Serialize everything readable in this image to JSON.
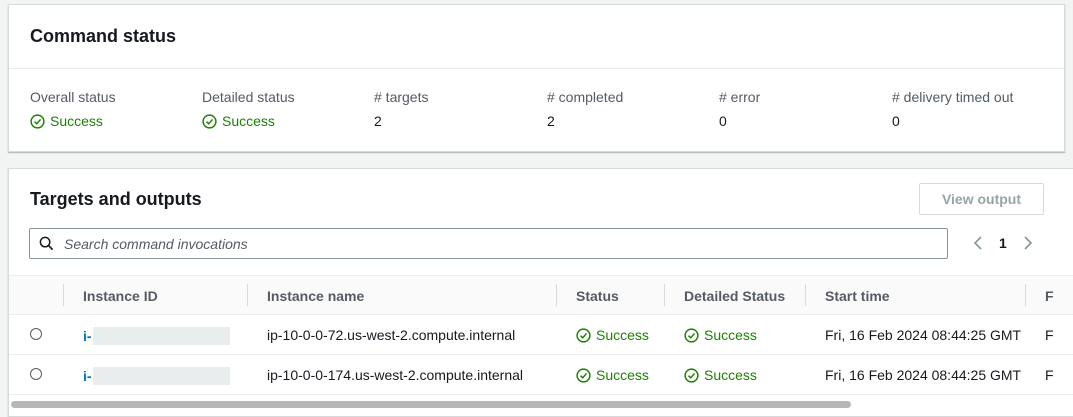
{
  "command_status": {
    "title": "Command status",
    "stats": [
      {
        "label": "Overall status",
        "value": "Success",
        "kind": "success"
      },
      {
        "label": "Detailed status",
        "value": "Success",
        "kind": "success"
      },
      {
        "label": "# targets",
        "value": "2",
        "kind": "plain"
      },
      {
        "label": "# completed",
        "value": "2",
        "kind": "plain"
      },
      {
        "label": "# error",
        "value": "0",
        "kind": "plain"
      },
      {
        "label": "# delivery timed out",
        "value": "0",
        "kind": "plain"
      }
    ]
  },
  "targets": {
    "title": "Targets and outputs",
    "view_output_label": "View output",
    "search_placeholder": "Search command invocations",
    "page": "1",
    "columns": [
      "Instance ID",
      "Instance name",
      "Status",
      "Detailed Status",
      "Start time",
      "F"
    ],
    "rows": [
      {
        "instance_id_prefix": "i-",
        "instance_name": "ip-10-0-0-72.us-west-2.compute.internal",
        "status": "Success",
        "detailed_status": "Success",
        "start_time": "Fri, 16 Feb 2024 08:44:25 GMT",
        "trailing": "F"
      },
      {
        "instance_id_prefix": "i-",
        "instance_name": "ip-10-0-0-174.us-west-2.compute.internal",
        "status": "Success",
        "detailed_status": "Success",
        "start_time": "Fri, 16 Feb 2024 08:44:25 GMT",
        "trailing": "F"
      }
    ]
  },
  "colors": {
    "success": "#1d8102",
    "link": "#0073bb",
    "background": "#f2f3f3"
  },
  "icons": [
    "success-check-icon",
    "search-icon",
    "chevron-left-icon",
    "chevron-right-icon",
    "radio-icon"
  ]
}
